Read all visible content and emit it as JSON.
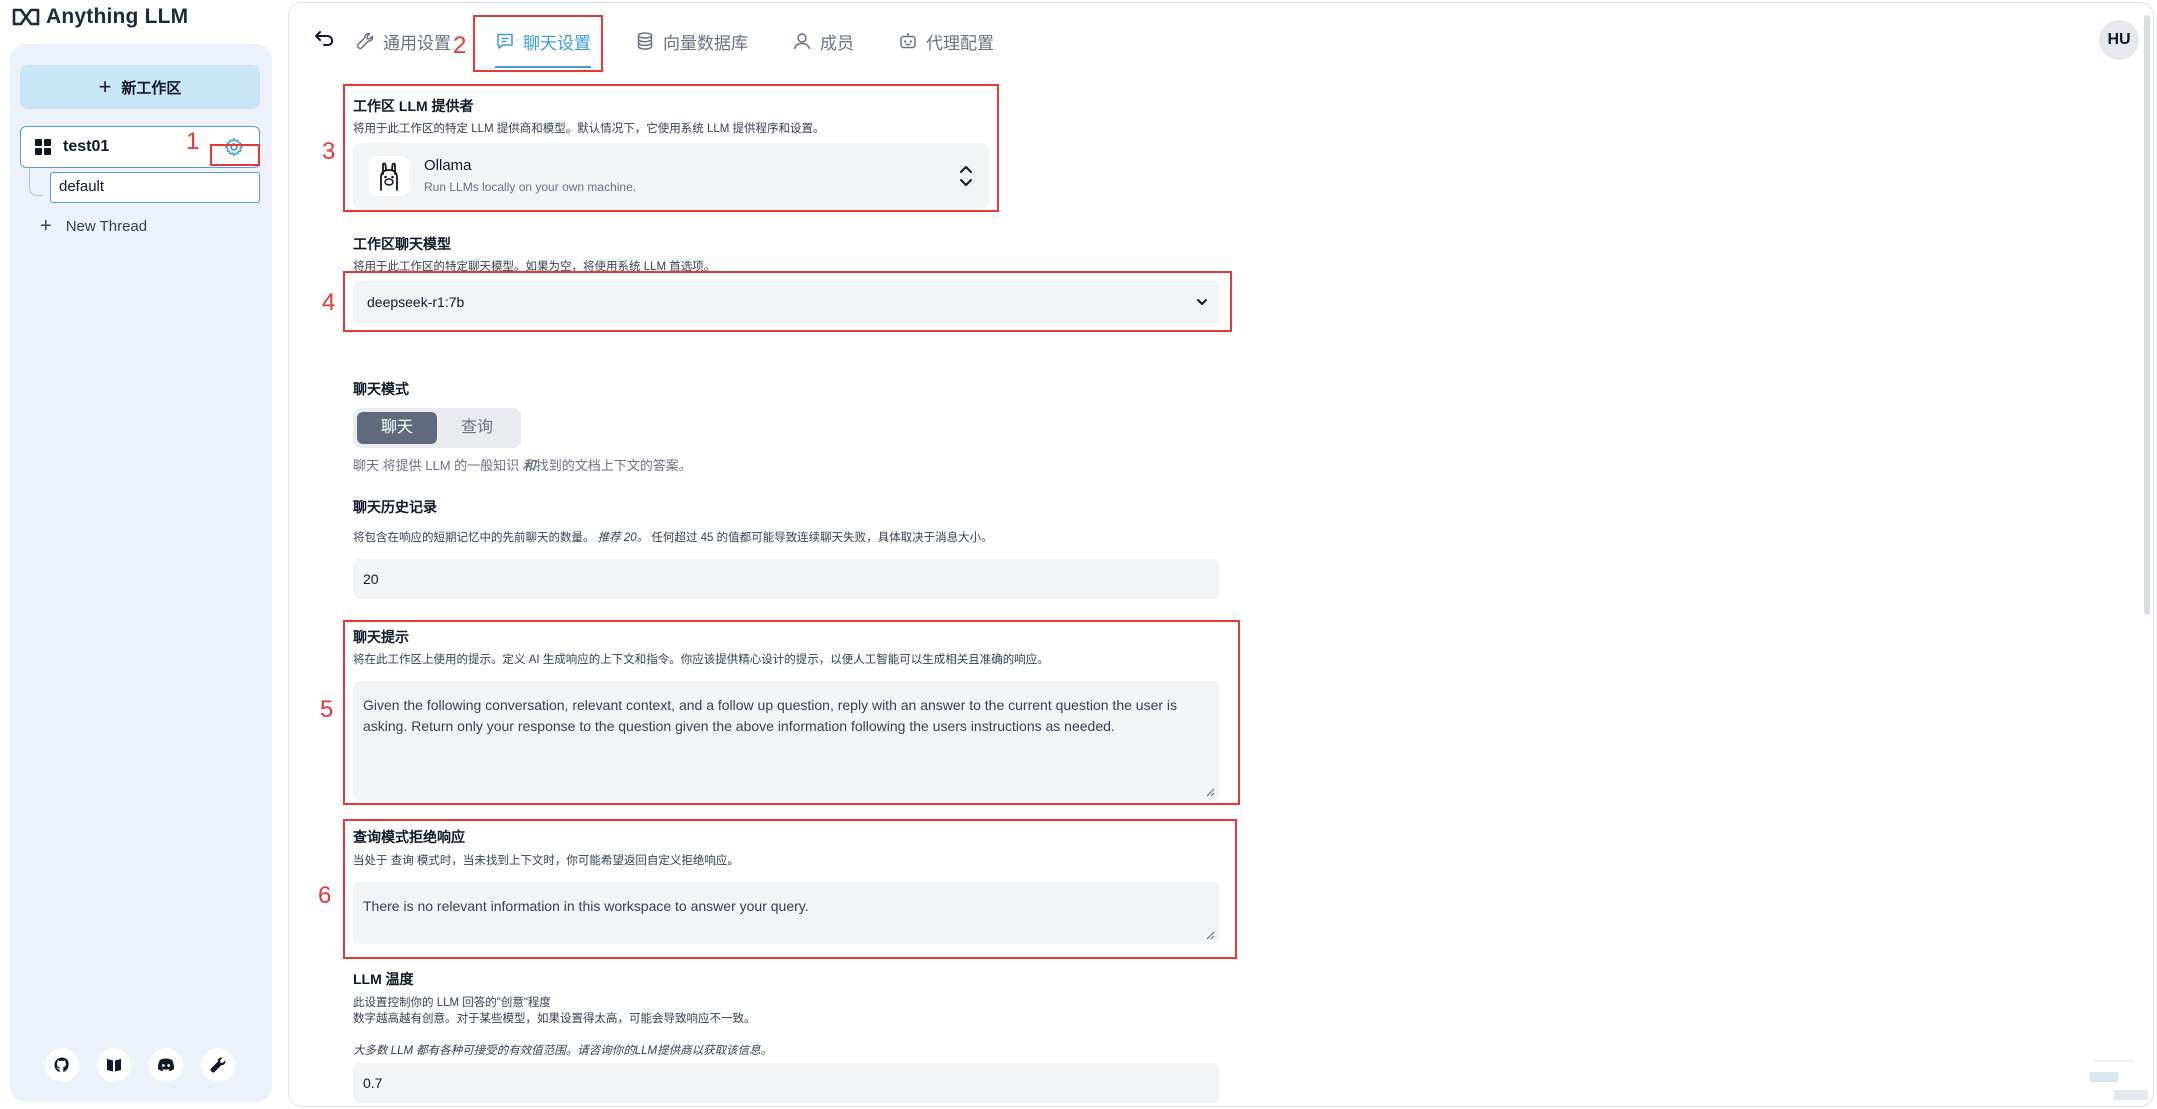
{
  "brand": {
    "name": "Anything LLM"
  },
  "sidebar": {
    "new_workspace": "新工作区",
    "workspace": {
      "name": "test01"
    },
    "thread": "default",
    "new_thread": "New Thread",
    "footer_icons": [
      "github-icon",
      "docs-book-icon",
      "discord-icon",
      "wrench-icon"
    ]
  },
  "tabs": [
    {
      "label": "通用设置",
      "icon": "wrench-icon"
    },
    {
      "label": "聊天设置",
      "icon": "chat-icon",
      "active": true
    },
    {
      "label": "向量数据库",
      "icon": "database-icon"
    },
    {
      "label": "成员",
      "icon": "user-icon"
    },
    {
      "label": "代理配置",
      "icon": "robot-icon"
    }
  ],
  "user": {
    "initials": "HU"
  },
  "provider": {
    "label": "工作区 LLM 提供者",
    "desc": "将用于此工作区的特定 LLM 提供商和模型。默认情况下，它使用系统 LLM 提供程序和设置。",
    "name": "Ollama",
    "sub": "Run LLMs locally on your own machine."
  },
  "model": {
    "label": "工作区聊天模型",
    "desc": "将用于此工作区的特定聊天模型。如果为空，将使用系统 LLM 首选项。",
    "value": "deepseek-r1:7b"
  },
  "mode": {
    "label": "聊天模式",
    "options": [
      "聊天",
      "查询"
    ],
    "selected": "聊天",
    "desc_prefix": "聊天",
    "desc_mid": " 将提供 LLM 的一般知识 ",
    "desc_em": "和",
    "desc_suffix": "找到的文档上下文的答案。"
  },
  "history": {
    "label": "聊天历史记录",
    "desc_a": "将包含在响应的短期记忆中的先前聊天的数量。 ",
    "desc_em": "推荐 20。",
    "desc_b": " 任何超过 45 的值都可能导致连续聊天失败，具体取决于消息大小。",
    "value": "20"
  },
  "prompt": {
    "label": "聊天提示",
    "desc": "将在此工作区上使用的提示。定义 AI 生成响应的上下文和指令。你应该提供精心设计的提示，以便人工智能可以生成相关且准确的响应。",
    "value": "Given the following conversation, relevant context, and a follow up question, reply with an answer to the current question the user is asking. Return only your response to the question given the above information following the users instructions as needed."
  },
  "refusal": {
    "label": "查询模式拒绝响应",
    "desc": "当处于 查询 模式时，当未找到上下文时，你可能希望返回自定义拒绝响应。",
    "value": "There is no relevant information in this workspace to answer your query."
  },
  "temperature": {
    "label": "LLM 温度",
    "desc1": "此设置控制你的 LLM 回答的\"创意\"程度",
    "desc2": "数字越高越有创意。对于某些模型，如果设置得太高，可能会导致响应不一致。",
    "note": "大多数 LLM 都有各种可接受的有效值范围。请咨询你的LLM提供商以获取该信息。",
    "value": "0.7"
  },
  "annotations": [
    "1",
    "2",
    "3",
    "4",
    "5",
    "6"
  ],
  "colors": {
    "accent": "#3b9be0",
    "annotation": "#e53935",
    "sidebar_bg": "#edf1f9",
    "field_bg": "#f3f4f6"
  }
}
